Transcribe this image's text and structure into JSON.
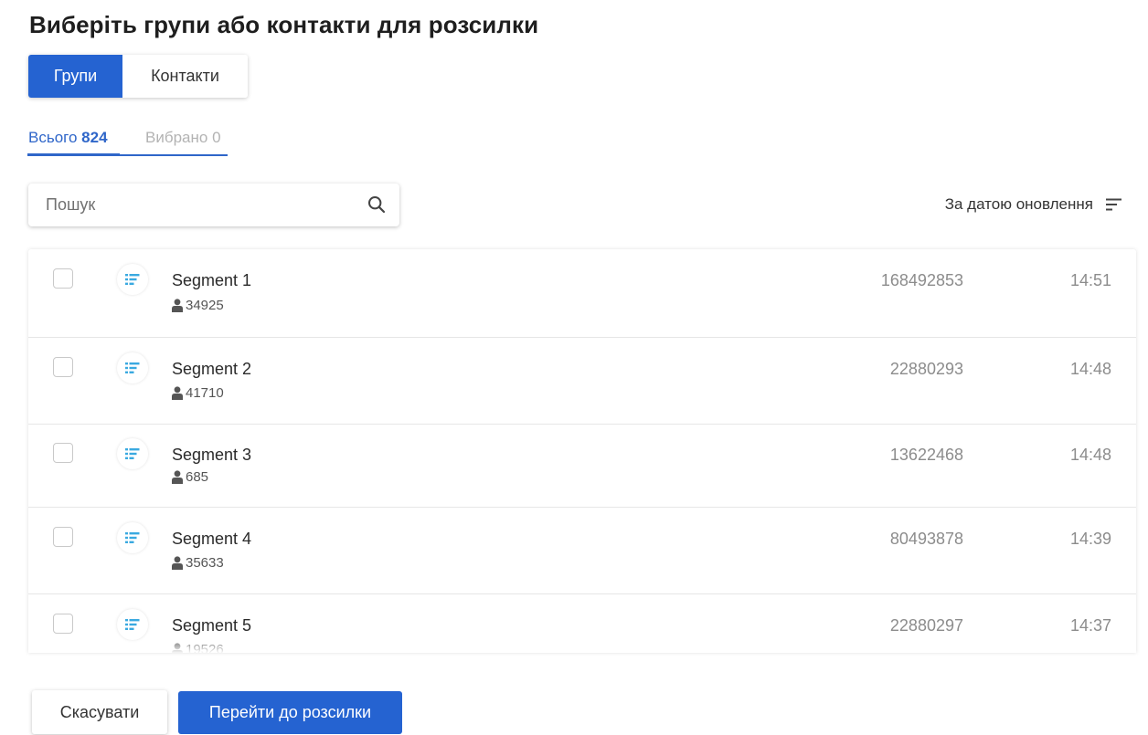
{
  "title": "Виберіть групи або контакти для розсилки",
  "toggle": {
    "groups_label": "Групи",
    "contacts_label": "Контакти",
    "active": "groups"
  },
  "tabs": {
    "total_label": "Всього",
    "total_count": "824",
    "selected_label": "Вибрано",
    "selected_count": "0"
  },
  "search": {
    "placeholder": "Пошук",
    "icon": "search-icon"
  },
  "sort": {
    "label": "За датою оновлення",
    "icon": "sort-lines-icon"
  },
  "groups": [
    {
      "name": "Segment 1",
      "contacts": "34925",
      "number": "168492853",
      "time": "14:51",
      "checked": false
    },
    {
      "name": "Segment 2",
      "contacts": "41710",
      "number": "22880293",
      "time": "14:48",
      "checked": false
    },
    {
      "name": "Segment 3",
      "contacts": "685",
      "number": "13622468",
      "time": "14:48",
      "checked": false
    },
    {
      "name": "Segment 4",
      "contacts": "35633",
      "number": "80493878",
      "time": "14:39",
      "checked": false
    },
    {
      "name": "Segment 5",
      "contacts": "19526",
      "number": "22880297",
      "time": "14:37",
      "checked": false
    }
  ],
  "footer": {
    "cancel_label": "Скасувати",
    "submit_label": "Перейти до розсилки"
  },
  "colors": {
    "accent": "#2563d1",
    "segment_icon": "#3aa9e0",
    "muted": "#8c8c8c"
  }
}
